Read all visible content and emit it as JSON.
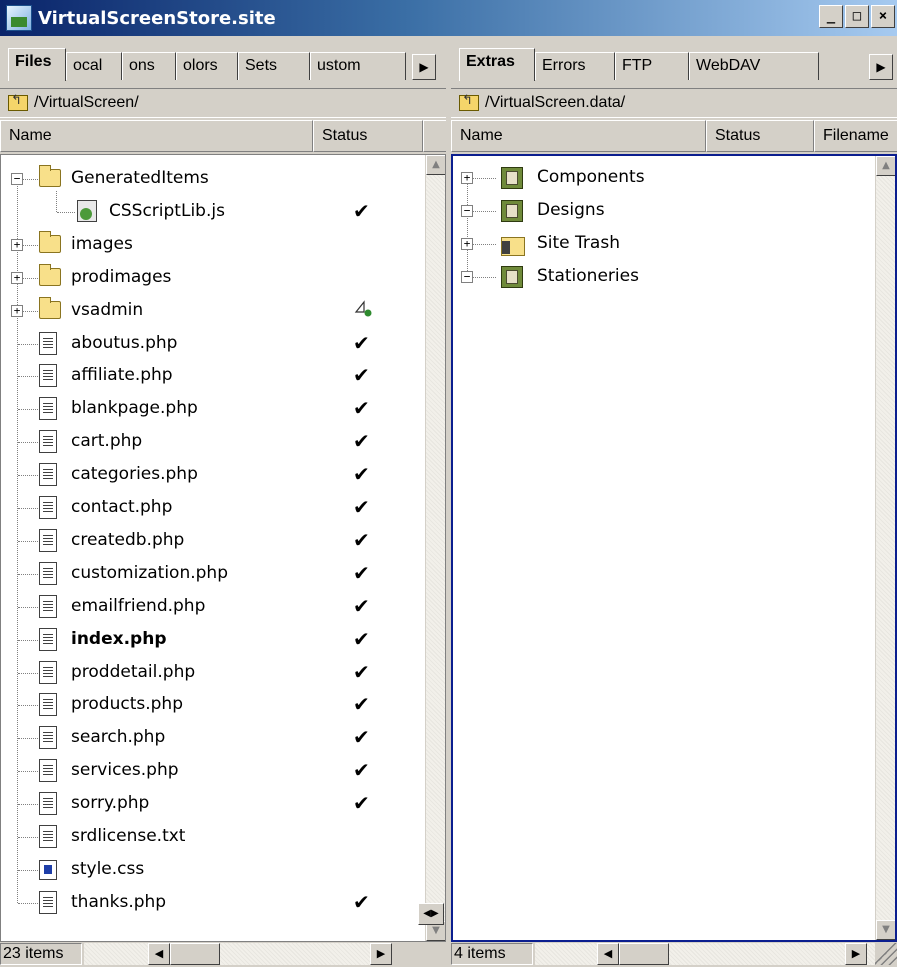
{
  "window": {
    "title": "VirtualScreenStore.site",
    "min_label": "_",
    "max_label": "□",
    "close_label": "×"
  },
  "left": {
    "tabs": [
      "Files",
      "ocal",
      "ons",
      "olors",
      "Sets",
      "ustom"
    ],
    "path": "/VirtualScreen/",
    "columns": {
      "name": "Name",
      "status": "Status"
    },
    "item_count": "23 items",
    "check_mark": "✔",
    "tree": [
      {
        "label": "GeneratedItems",
        "kind": "folder",
        "expander": "−",
        "status": ""
      },
      {
        "label": "CSScriptLib.js",
        "kind": "js",
        "status": "check"
      },
      {
        "label": "images",
        "kind": "folder",
        "expander": "+",
        "status": ""
      },
      {
        "label": "prodimages",
        "kind": "folder",
        "expander": "+",
        "status": ""
      },
      {
        "label": "vsadmin",
        "kind": "folder",
        "expander": "+",
        "status": "mixed"
      },
      {
        "label": "aboutus.php",
        "kind": "file",
        "status": "check"
      },
      {
        "label": "affiliate.php",
        "kind": "file",
        "status": "check"
      },
      {
        "label": "blankpage.php",
        "kind": "file",
        "status": "check"
      },
      {
        "label": "cart.php",
        "kind": "file",
        "status": "check"
      },
      {
        "label": "categories.php",
        "kind": "file",
        "status": "check"
      },
      {
        "label": "contact.php",
        "kind": "file",
        "status": "check"
      },
      {
        "label": "createdb.php",
        "kind": "file",
        "status": "check"
      },
      {
        "label": "customization.php",
        "kind": "file",
        "status": "check"
      },
      {
        "label": "emailfriend.php",
        "kind": "file",
        "status": "check"
      },
      {
        "label": "index.php",
        "kind": "file",
        "status": "check",
        "bold": true
      },
      {
        "label": "proddetail.php",
        "kind": "file",
        "status": "check"
      },
      {
        "label": "products.php",
        "kind": "file",
        "status": "check"
      },
      {
        "label": "search.php",
        "kind": "file",
        "status": "check"
      },
      {
        "label": "services.php",
        "kind": "file",
        "status": "check"
      },
      {
        "label": "sorry.php",
        "kind": "file",
        "status": "check"
      },
      {
        "label": "srdlicense.txt",
        "kind": "file",
        "status": ""
      },
      {
        "label": "style.css",
        "kind": "css",
        "status": ""
      },
      {
        "label": "thanks.php",
        "kind": "file",
        "status": "check"
      }
    ]
  },
  "right": {
    "tabs": [
      "Extras",
      "Errors",
      "FTP",
      "WebDAV"
    ],
    "path": "/VirtualScreen.data/",
    "columns": {
      "name": "Name",
      "status": "Status",
      "filename": "Filename"
    },
    "item_count": "4 items",
    "tree": [
      {
        "label": "Components",
        "kind": "design",
        "expander": "+"
      },
      {
        "label": "Designs",
        "kind": "design",
        "expander": "−"
      },
      {
        "label": "Site Trash",
        "kind": "trash",
        "expander": "+"
      },
      {
        "label": "Stationeries",
        "kind": "design",
        "expander": "−"
      }
    ]
  }
}
